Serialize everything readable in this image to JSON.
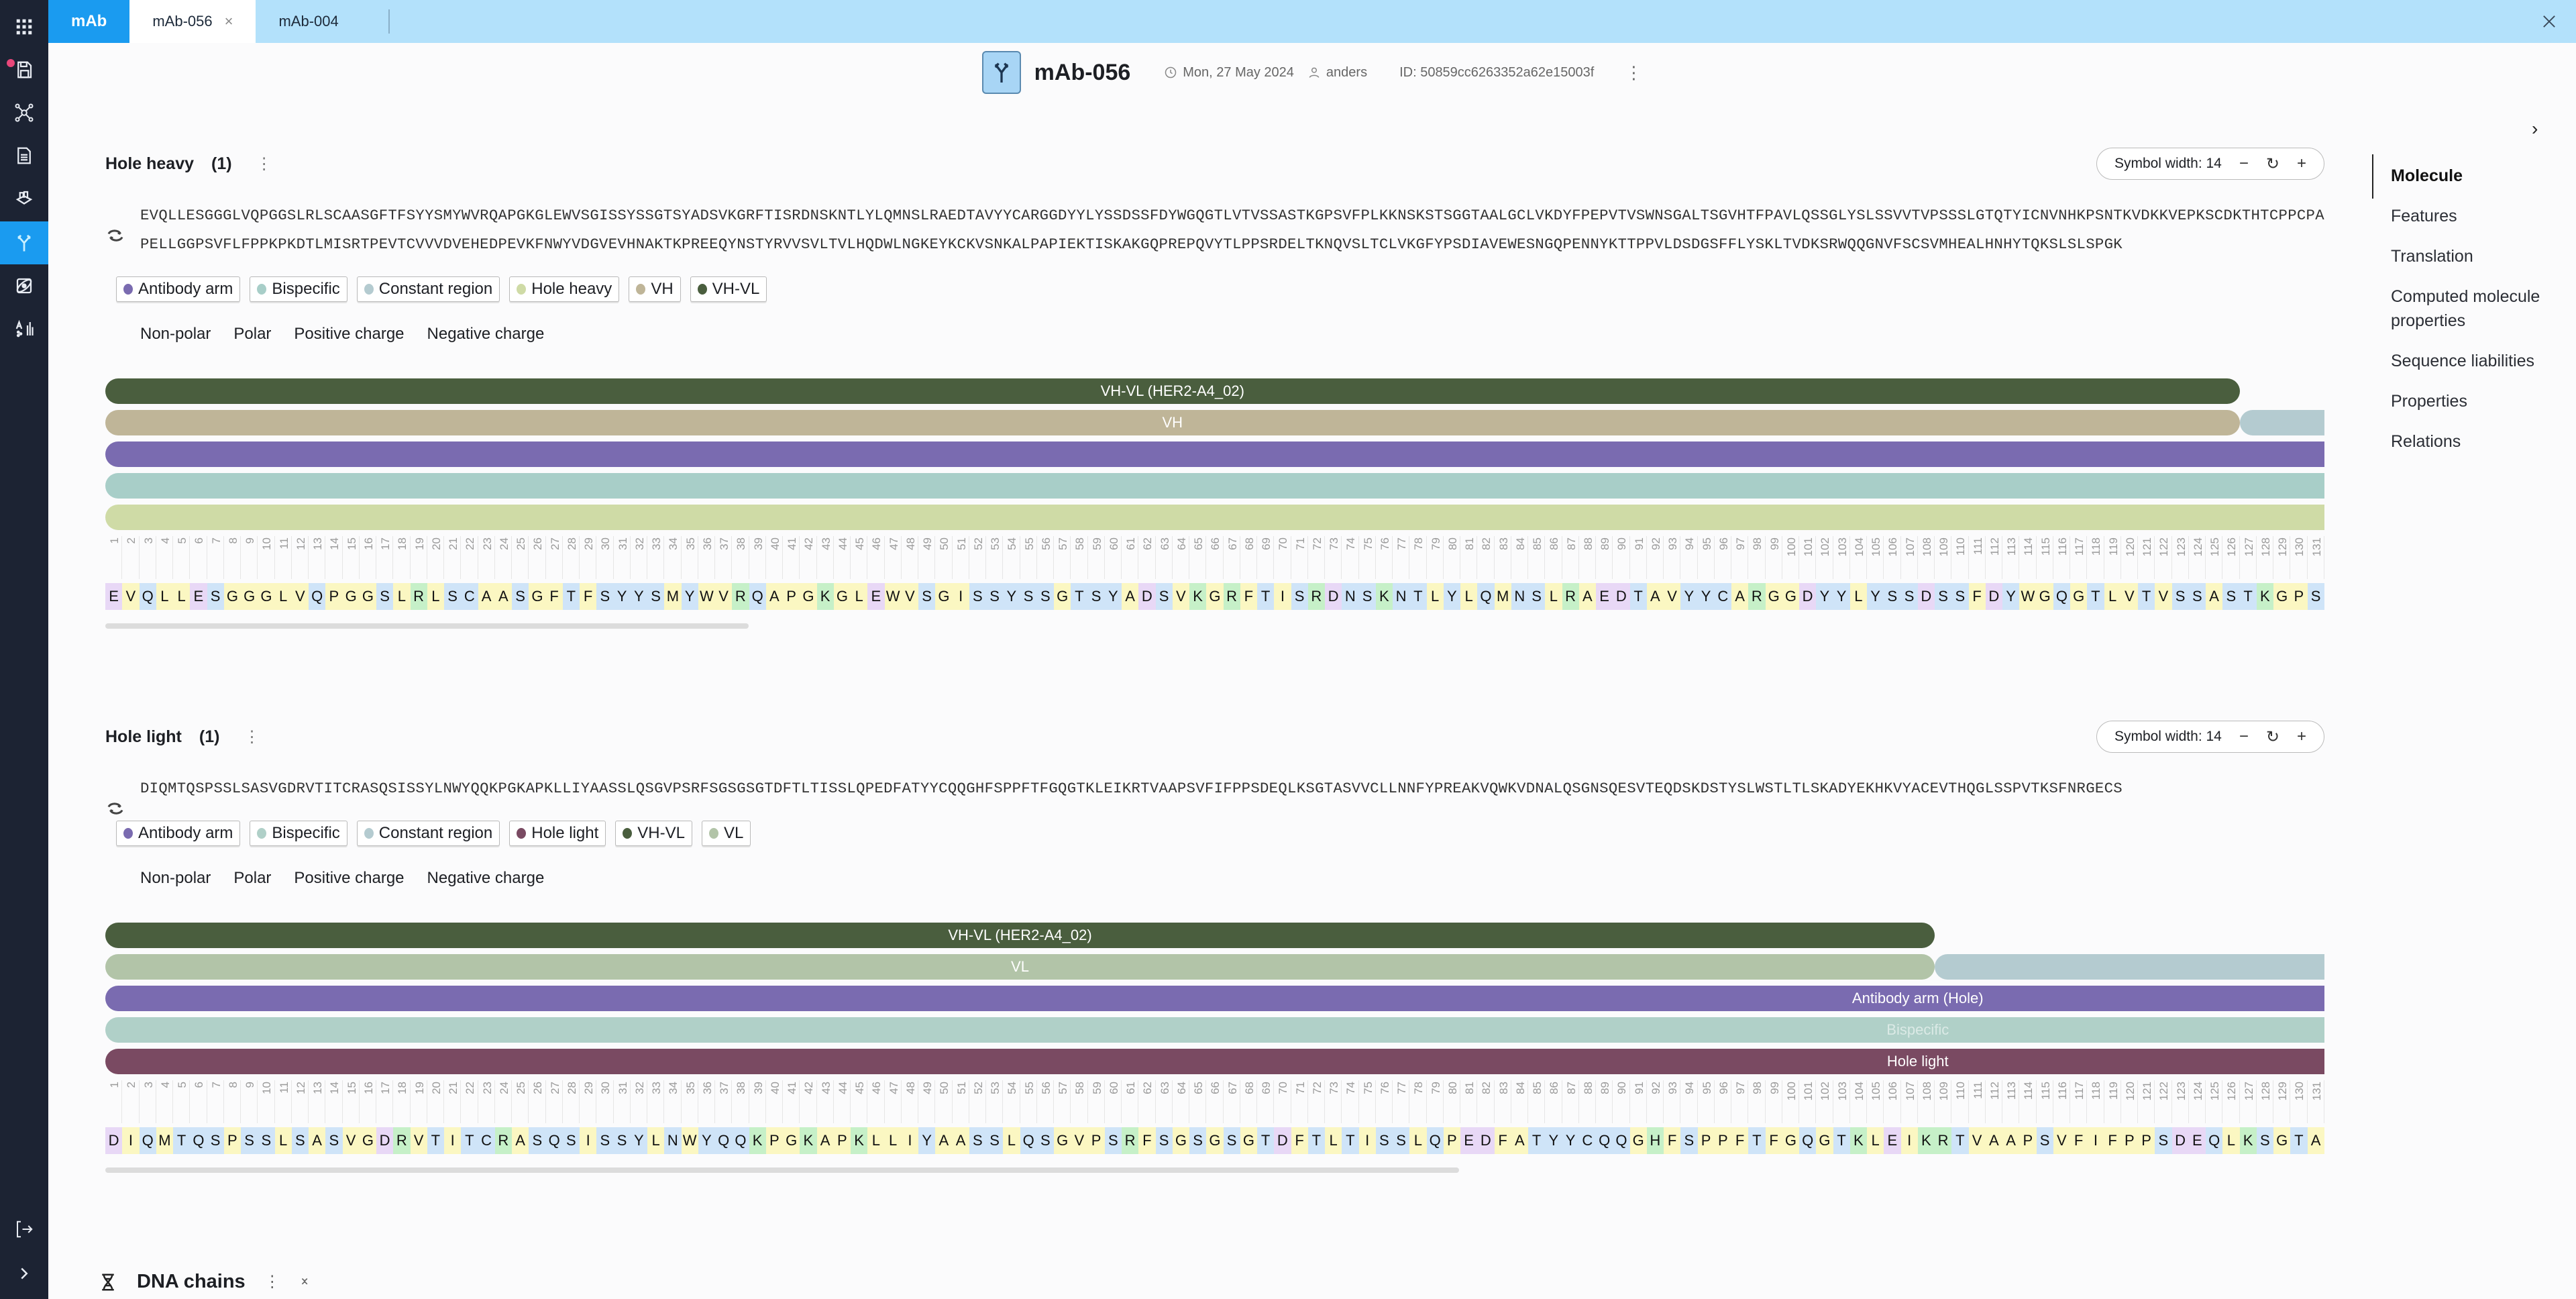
{
  "tabs": {
    "app_label": "mAb",
    "items": [
      {
        "label": "mAb-056",
        "active": true,
        "closable": true
      },
      {
        "label": "mAb-004",
        "active": false,
        "closable": false
      }
    ]
  },
  "sidebar": {
    "items": [
      {
        "icon": "apps-grid-icon"
      },
      {
        "icon": "save-icon",
        "badge": true
      },
      {
        "icon": "network-icon"
      },
      {
        "icon": "document-icon"
      },
      {
        "icon": "inventory-icon"
      },
      {
        "icon": "antibody-icon",
        "active": true
      },
      {
        "icon": "orbit-icon"
      },
      {
        "icon": "analysis-icon"
      }
    ],
    "bottom": [
      {
        "icon": "logout-icon"
      },
      {
        "icon": "expand-icon"
      }
    ]
  },
  "header": {
    "title": "mAb-056",
    "date": "Mon, 27 May 2024",
    "user": "anders",
    "id_label": "ID: 50859cc6263352a62e15003f"
  },
  "right_nav": {
    "items": [
      {
        "label": "Molecule",
        "active": true
      },
      {
        "label": "Features"
      },
      {
        "label": "Translation"
      },
      {
        "label": "Computed molecule properties"
      },
      {
        "label": "Sequence liabilities"
      },
      {
        "label": "Properties"
      },
      {
        "label": "Relations"
      }
    ]
  },
  "legend": {
    "labels": [
      "Non-polar",
      "Polar",
      "Positive charge",
      "Negative charge"
    ],
    "colors": {
      "nonpolar": "#fbf7c2",
      "polar": "#cfe4f8",
      "positive": "#c6f0c8",
      "negative": "#e8d8f6"
    }
  },
  "chains": [
    {
      "title": "Hole heavy",
      "count": "(1)",
      "symbol_width": "Symbol width: 14",
      "sequence": "EVQLLESGGGLVQPGGSLRLSCAASGFTFSYYSMYWVRQAPGKGLEWVSGISSYSSGTSYADSVKGRFTISRDNSKNTLYLQMNSLRAEDTAVYYCARGGDYYLYSSDSSFDYWGQGTLVTVSSASTKGPSVFPLKKNSKSTSGGTAALGCLVKDYFPEPVTVSWNSGALTSGVHTFPAVLQSSGLYSLSSVVTVPSSSLGTQTYICNVNHKPSNTKVDKKVEPKSCDKTHTCPPCPAPELLGGPSVFLFPPKPKDTLMISRTPEVTCVVVDVEHEDPEVKFNWYVDGVEVHNAKTKPREEQYNSTYRVVSVLTVLHQDWLNGKEYKCKVSNKALPAPIEKTISKAKGQPREPQVYTLPPSRDELTKNQVSLTCLVKGFYPSDIAVEWESNGQPENNYKTTPPVLDSDGSFFLYSKLTVDKSRWQQGNVFSCSVMHEALHNHYTQKSLSLSPGK",
      "chips": [
        {
          "label": "Antibody arm",
          "color": "#7a6bb0"
        },
        {
          "label": "Bispecific",
          "color": "#a8cec8"
        },
        {
          "label": "Constant region",
          "color": "#b4cbd0"
        },
        {
          "label": "Hole heavy",
          "color": "#cfdba6"
        },
        {
          "label": "VH",
          "color": "#bfb598"
        },
        {
          "label": "VH-VL",
          "color": "#4a5e3e"
        }
      ],
      "tracks": [
        [
          {
            "label": "VH-VL (HER2-A4_02)",
            "start": 1,
            "end": 126,
            "color": "#4a5e3e"
          }
        ],
        [
          {
            "label": "VH",
            "start": 1,
            "end": 126,
            "color": "#bfb598"
          },
          {
            "label": "",
            "start": 127,
            "end": 131,
            "color": "#b4cbd0"
          }
        ],
        [
          {
            "label": "",
            "start": 1,
            "end": 131,
            "color": "#7a6bb0"
          }
        ],
        [
          {
            "label": "",
            "start": 1,
            "end": 131,
            "color": "#a8cec8"
          }
        ],
        [
          {
            "label": "",
            "start": 1,
            "end": 131,
            "color": "#cfdba6"
          }
        ]
      ],
      "visible_residues": 131,
      "scroll_fraction": 0.29
    },
    {
      "title": "Hole light",
      "count": "(1)",
      "symbol_width": "Symbol width: 14",
      "sequence": "DIQMTQSPSSLSASVGDRVTITCRASQSISSYLNWYQQKPGKAPKLLIYAASSLQSGVPSRFSGSGSGTDFTLTISSLQPEDFATYYCQQGHFSPPFTFGQGTKLEIKRTVAAPSVFIFPPSDEQLKSGTASVVCLLNNFYPREAKVQWKVDNALQSGNSQESVTEQDSKDSTYSLWSTLTLSKADYEKHKVYACEVTHQGLSSPVTKSFNRGECS",
      "chips": [
        {
          "label": "Antibody arm",
          "color": "#7a6bb0"
        },
        {
          "label": "Bispecific",
          "color": "#b0d0c8"
        },
        {
          "label": "Constant region",
          "color": "#b4cbd0"
        },
        {
          "label": "Hole light",
          "color": "#7a4a62"
        },
        {
          "label": "VH-VL",
          "color": "#4a5e3e"
        },
        {
          "label": "VL",
          "color": "#b2c4a8"
        }
      ],
      "tracks": [
        [
          {
            "label": "VH-VL (HER2-A4_02)",
            "start": 1,
            "end": 108,
            "color": "#4a5e3e"
          }
        ],
        [
          {
            "label": "VL",
            "start": 1,
            "end": 108,
            "color": "#b2c4a8"
          },
          {
            "label": "",
            "start": 109,
            "end": 131,
            "color": "#b4cbd0"
          }
        ],
        [
          {
            "label": "Antibody arm (Hole)",
            "start": 1,
            "end": 131,
            "color": "#7a6bb0",
            "label_at": 108
          }
        ],
        [
          {
            "label": "Bispecific",
            "start": 1,
            "end": 131,
            "color": "#b0d0c8",
            "label_at": 108,
            "faint": true
          }
        ],
        [
          {
            "label": "Hole light",
            "start": 1,
            "end": 131,
            "color": "#7a4a62",
            "label_at": 108
          }
        ]
      ],
      "visible_residues": 131,
      "scroll_fraction": 0.61
    }
  ],
  "dna_section": {
    "title": "DNA chains"
  }
}
